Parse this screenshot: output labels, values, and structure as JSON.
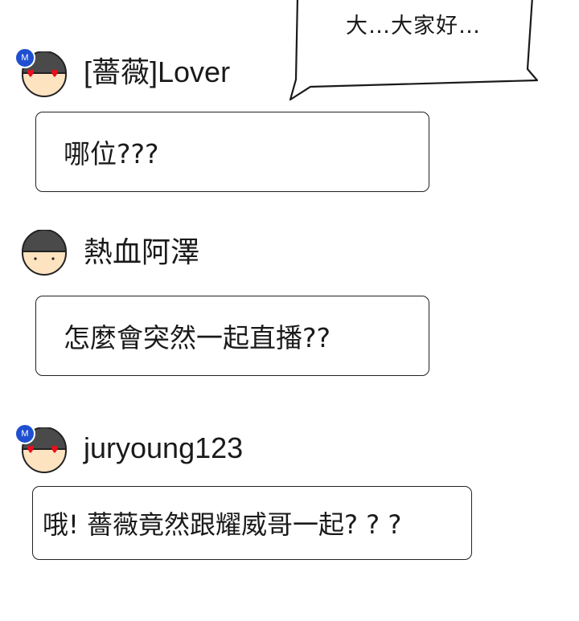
{
  "speech": {
    "text": "大…大家好…"
  },
  "messages": [
    {
      "username": "[薔薇]Lover",
      "badge": "M",
      "avatar_icon": "heart-eyes-face",
      "text": "哪位???"
    },
    {
      "username": "熱血阿澤",
      "badge": "",
      "avatar_icon": "plain-face",
      "text": "怎麼會突然一起直播??"
    },
    {
      "username": "juryoung123",
      "badge": "M",
      "avatar_icon": "heart-eyes-face",
      "text": "哦! 薔薇竟然跟耀威哥一起? ? ?"
    }
  ],
  "colors": {
    "badge": "#1f4fd1",
    "hair": "#4a4a4a",
    "skin": "#fde3c0",
    "heart": "#e8101c"
  }
}
